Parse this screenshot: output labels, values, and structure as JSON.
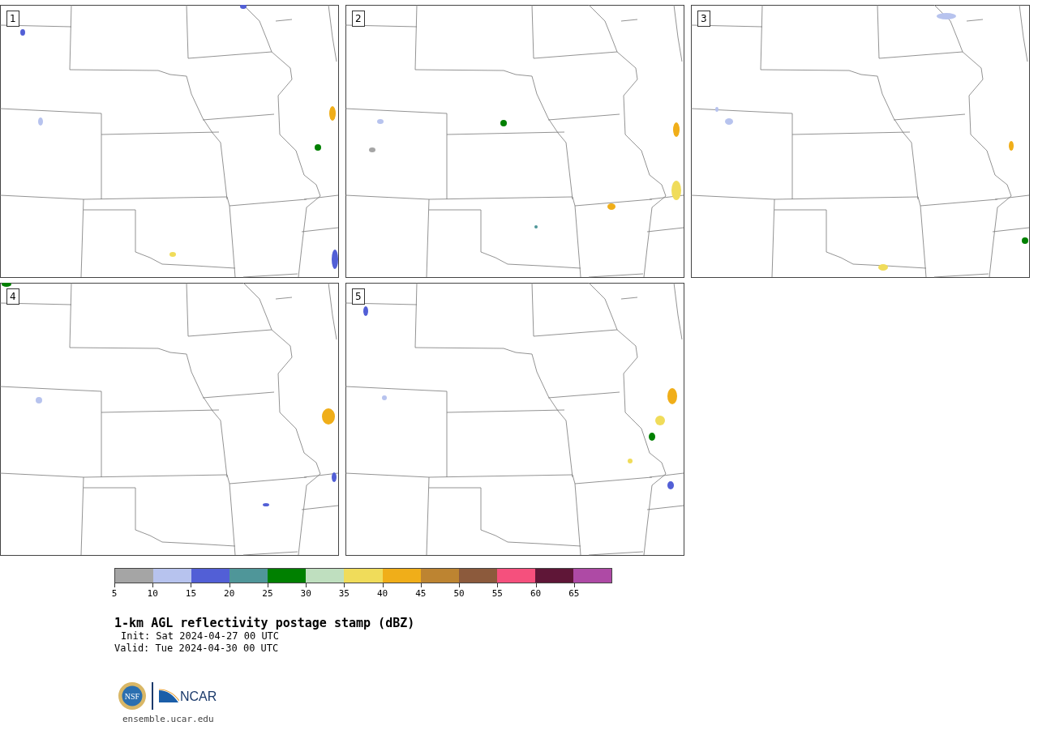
{
  "panels": [
    {
      "label": "1"
    },
    {
      "label": "2"
    },
    {
      "label": "3"
    },
    {
      "label": "4"
    },
    {
      "label": "5"
    }
  ],
  "colorbar": {
    "bins": [
      {
        "color": "#a5a5a5"
      },
      {
        "color": "#b7c3ee"
      },
      {
        "color": "#525fd6"
      },
      {
        "color": "#4f9699"
      },
      {
        "color": "#008000"
      },
      {
        "color": "#bfdfbf"
      },
      {
        "color": "#f0dc5a"
      },
      {
        "color": "#f0ae19"
      },
      {
        "color": "#bd8431"
      },
      {
        "color": "#8c5a3c"
      },
      {
        "color": "#f5507d"
      },
      {
        "color": "#5f1637"
      },
      {
        "color": "#ae4aa5"
      }
    ],
    "ticks": [
      "5",
      "10",
      "15",
      "20",
      "25",
      "30",
      "35",
      "40",
      "45",
      "50",
      "55",
      "60",
      "65"
    ]
  },
  "title": "1-km AGL reflectivity postage stamp (dBZ)",
  "init": "Init: Sat 2024-04-27 00 UTC",
  "valid": "Valid: Tue 2024-04-30 00 UTC",
  "logos": {
    "nsf": "NSF",
    "ncar": "NCAR"
  },
  "url": "ensemble.ucar.edu"
}
